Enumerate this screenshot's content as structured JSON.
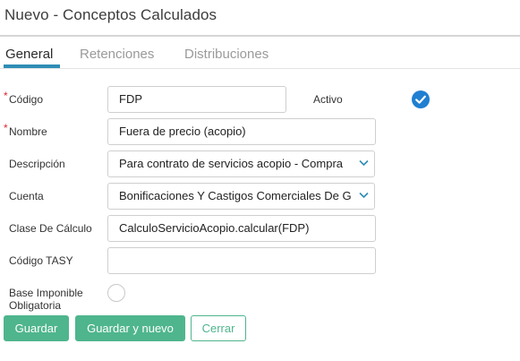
{
  "window": {
    "title": "Nuevo - Conceptos Calculados"
  },
  "tabs": [
    {
      "label": "General",
      "active": true
    },
    {
      "label": "Retenciones",
      "active": false
    },
    {
      "label": "Distribuciones",
      "active": false
    }
  ],
  "form": {
    "codigo": {
      "label": "Código",
      "value": "FDP",
      "required": true
    },
    "activo": {
      "label": "Activo",
      "checked": true
    },
    "nombre": {
      "label": "Nombre",
      "value": "Fuera de precio (acopio)",
      "required": true
    },
    "descripcion": {
      "label": "Descripción",
      "value": "Para contrato de servicios acopio - Compra"
    },
    "cuenta": {
      "label": "Cuenta",
      "value": "Bonificaciones Y Castigos Comerciales De G"
    },
    "clase_calculo": {
      "label": "Clase De Cálculo",
      "value": "CalculoServicioAcopio.calcular(FDP)"
    },
    "codigo_tasy": {
      "label": "Código TASY",
      "value": ""
    },
    "base_imponible": {
      "label_line1": "Base Imponible",
      "label_line2": "Obligatoria",
      "checked": false
    }
  },
  "buttons": {
    "save": "Guardar",
    "save_new": "Guardar y nuevo",
    "close": "Cerrar"
  },
  "required_marker": "*",
  "colors": {
    "accent": "#2f8db5",
    "primary_button": "#4fb58d",
    "check": "#1f7fd1",
    "required": "#d9282f"
  },
  "icons": {
    "activo": "check-circle-icon",
    "select": "chevron-down-icon"
  }
}
